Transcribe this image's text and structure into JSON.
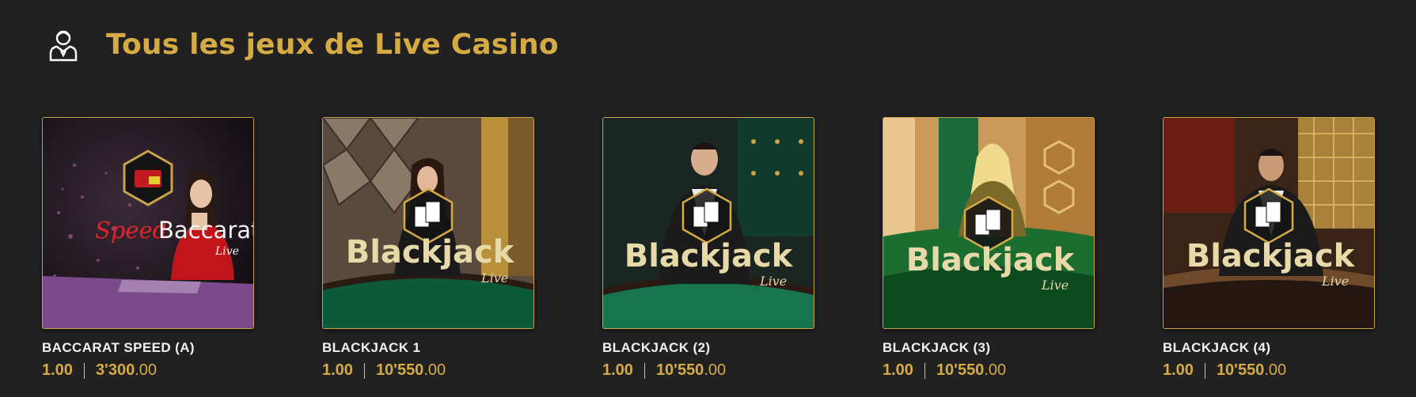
{
  "header": {
    "title": "Tous les jeux de Live Casino",
    "icon": "dealer-icon"
  },
  "colors": {
    "background": "#212121",
    "accent": "#d6ab44",
    "border": "#c9a24a"
  },
  "games": [
    {
      "name": "BACCARAT SPEED (A)",
      "min": "1.00",
      "max_main": "3'300",
      "max_dec": ".00",
      "logo_left": "Speed",
      "logo_right": "Baccarat",
      "logo_sub": "Live",
      "theme": "baccarat"
    },
    {
      "name": "BLACKJACK 1",
      "min": "1.00",
      "max_main": "10'550",
      "max_dec": ".00",
      "logo_main": "Blackjack",
      "logo_sub": "Live",
      "theme": "bj1"
    },
    {
      "name": "BLACKJACK (2)",
      "min": "1.00",
      "max_main": "10'550",
      "max_dec": ".00",
      "logo_main": "Blackjack",
      "logo_sub": "Live",
      "theme": "bj2"
    },
    {
      "name": "BLACKJACK (3)",
      "min": "1.00",
      "max_main": "10'550",
      "max_dec": ".00",
      "logo_main": "Blackjack",
      "logo_sub": "Live",
      "theme": "bj3"
    },
    {
      "name": "BLACKJACK (4)",
      "min": "1.00",
      "max_main": "10'550",
      "max_dec": ".00",
      "logo_main": "Blackjack",
      "logo_sub": "Live",
      "theme": "bj4"
    }
  ]
}
